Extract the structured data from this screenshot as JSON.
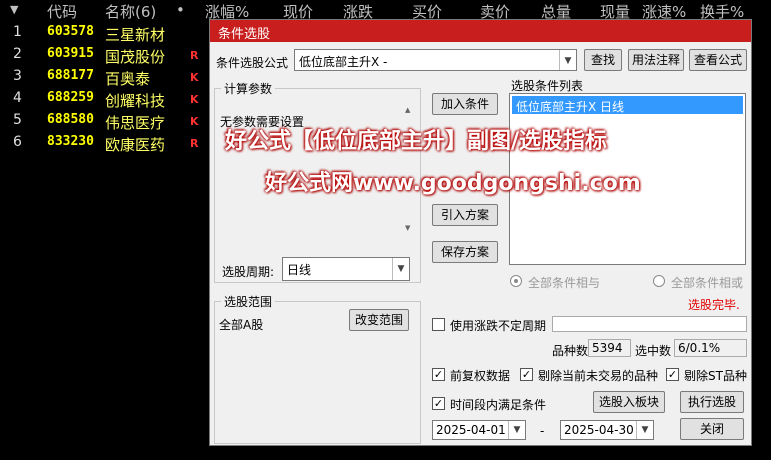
{
  "columns": {
    "code": "代码",
    "name": "名称(6)",
    "dot": "•",
    "change_pct": "涨幅%",
    "price": "现价",
    "change": "涨跌",
    "bid": "买价",
    "ask": "卖价",
    "volume": "总量",
    "cur_vol": "现量",
    "speed": "涨速%",
    "turnover": "换手%"
  },
  "header_arrow": "▼",
  "rows": [
    {
      "idx": "1",
      "code": "603578",
      "name": "三星新材",
      "flag": ""
    },
    {
      "idx": "2",
      "code": "603915",
      "name": "国茂股份",
      "flag": "R"
    },
    {
      "idx": "3",
      "code": "688177",
      "name": "百奥泰",
      "flag": "K"
    },
    {
      "idx": "4",
      "code": "688259",
      "name": "创耀科技",
      "flag": "K"
    },
    {
      "idx": "5",
      "code": "688580",
      "name": "伟思医疗",
      "flag": "K"
    },
    {
      "idx": "6",
      "code": "833230",
      "name": "欧康医药",
      "flag": "R"
    }
  ],
  "dialog": {
    "title": "条件选股",
    "formula_label": "条件选股公式",
    "formula_value": "低位底部主升X -",
    "btn_find": "查找",
    "btn_usage": "用法注释",
    "btn_view": "查看公式",
    "params_group": "计算参数",
    "params_text": "无参数需要设置",
    "btn_add": "加入条件",
    "btn_import": "引入方案",
    "btn_save": "保存方案",
    "period_label": "选股周期:",
    "period_value": "日线",
    "list_title": "选股条件列表",
    "list_item": "低位底部主升X  日线",
    "radio_and": "全部条件相与",
    "radio_or": "全部条件相或",
    "status": "选股完毕.",
    "range_group": "选股范围",
    "range_value": "全部A股",
    "btn_change_range": "改变范围",
    "use_uncertain": "使用涨跌不定周期",
    "count_label": "品种数",
    "count_value": "5394",
    "selected_label": "选中数",
    "selected_value": "6/0.1%",
    "chk_adjust": "前复权数据",
    "chk_exclude_untraded": "剔除当前未交易的品种",
    "chk_exclude_st": "剔除ST品种",
    "chk_period": "时间段内满足条件",
    "btn_to_board": "选股入板块",
    "btn_execute": "执行选股",
    "date_from": "2025-04-01",
    "date_sep": "-",
    "date_to": "2025-04-30",
    "btn_close": "关闭"
  },
  "watermark_1": "好公式【低位底部主升】副图/选股指标",
  "watermark_2": "好公式网www.goodgongshi.com",
  "colors": {
    "title_bar": "#c81e1e",
    "status_text": "#e00000",
    "code_color": "#ffff00",
    "selection": "#3399ff"
  }
}
